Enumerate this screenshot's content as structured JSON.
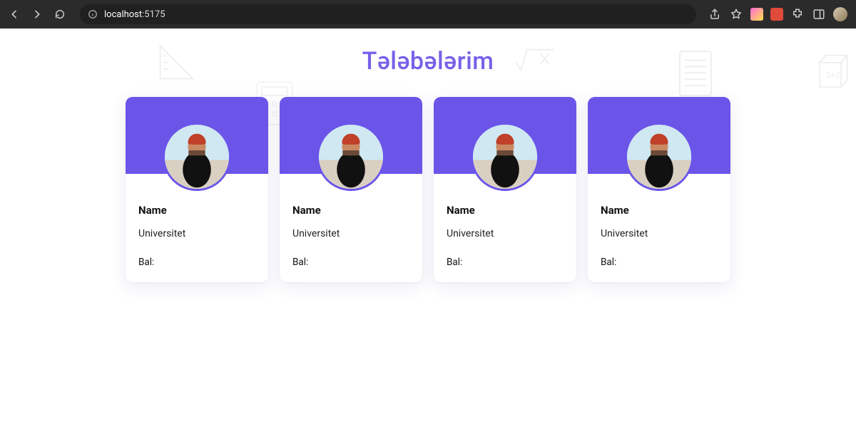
{
  "browser": {
    "url_host": "localhost",
    "url_port": ":5175"
  },
  "page": {
    "title": "Tələbələrim"
  },
  "students": [
    {
      "name": "Name",
      "university": "Universitet",
      "score_label": "Bal:"
    },
    {
      "name": "Name",
      "university": "Universitet",
      "score_label": "Bal:"
    },
    {
      "name": "Name",
      "university": "Universitet",
      "score_label": "Bal:"
    },
    {
      "name": "Name",
      "university": "Universitet",
      "score_label": "Bal:"
    }
  ],
  "colors": {
    "accent": "#6b55e9",
    "title": "#7661e8"
  }
}
